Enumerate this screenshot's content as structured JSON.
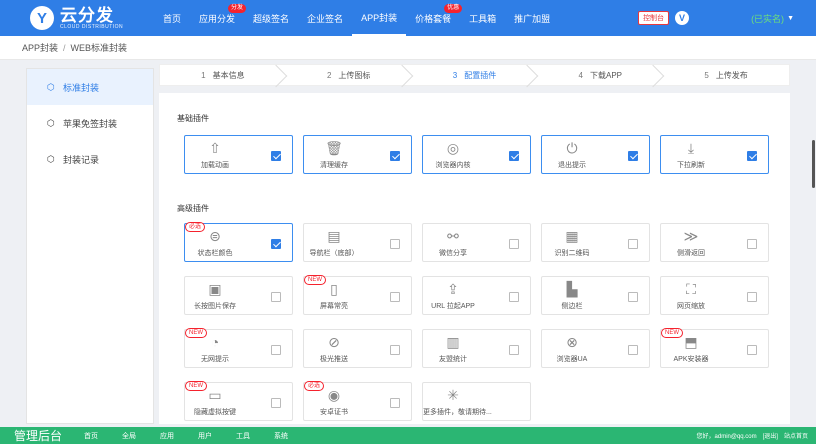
{
  "brand": {
    "name": "云分发",
    "sub": "CLOUD DISTRIBUTION",
    "letter": "Y"
  },
  "nav": {
    "items": [
      {
        "label": "首页",
        "badge": ""
      },
      {
        "label": "应用分发",
        "badge": "分发"
      },
      {
        "label": "超级签名",
        "badge": ""
      },
      {
        "label": "企业签名",
        "badge": ""
      },
      {
        "label": "APP封装",
        "badge": "",
        "active": true
      },
      {
        "label": "价格套餐",
        "badge": "优惠"
      },
      {
        "label": "工具箱",
        "badge": ""
      },
      {
        "label": "推广加盟",
        "badge": ""
      }
    ],
    "ctrl_label": "控制台",
    "vip": "V",
    "realname": "(已实名)",
    "caret": "▼"
  },
  "breadcrumb": {
    "a": "APP封装",
    "sep": "/",
    "b": "WEB标准封装"
  },
  "sidebar": [
    {
      "label": "标准封装",
      "icon": "⬡",
      "active": true
    },
    {
      "label": "苹果免签封装",
      "icon": "⬡"
    },
    {
      "label": "封装记录",
      "icon": "⬡"
    }
  ],
  "steps": [
    {
      "num": "1",
      "label": "基本信息"
    },
    {
      "num": "2",
      "label": "上传图标"
    },
    {
      "num": "3",
      "label": "配置插件",
      "active": true
    },
    {
      "num": "4",
      "label": "下载APP"
    },
    {
      "num": "5",
      "label": "上传发布"
    }
  ],
  "sections": {
    "basic": "基础插件",
    "advanced": "高级插件"
  },
  "basic_plugins": [
    {
      "label": "加载动画",
      "icon": "⇧",
      "checked": true
    },
    {
      "label": "清理缓存",
      "icon": "🗑",
      "checked": true
    },
    {
      "label": "浏览器内核",
      "icon": "◎",
      "checked": true
    },
    {
      "label": "退出提示",
      "icon": "⏻",
      "checked": true
    },
    {
      "label": "下拉刷新",
      "icon": "⤓",
      "checked": true
    }
  ],
  "advanced_plugins": [
    {
      "label": "状态栏颜色",
      "icon": "⊜",
      "checked": true,
      "tag": "必选"
    },
    {
      "label": "导航栏（底部）",
      "icon": "▤",
      "checked": false
    },
    {
      "label": "微信分享",
      "icon": "⚯",
      "checked": false
    },
    {
      "label": "识别二维码",
      "icon": "▦",
      "checked": false
    },
    {
      "label": "侧滑返回",
      "icon": "≫",
      "checked": false
    },
    {
      "label": "长按图片保存",
      "icon": "▣",
      "checked": false
    },
    {
      "label": "屏幕常亮",
      "icon": "▯",
      "checked": false,
      "tag": "NEW"
    },
    {
      "label": "URL 拉起APP",
      "icon": "⇪",
      "checked": false
    },
    {
      "label": "侧边栏",
      "icon": "▙",
      "checked": false
    },
    {
      "label": "网页缩放",
      "icon": "⛶",
      "checked": false
    },
    {
      "label": "无网提示",
      "icon": "◔",
      "checked": false,
      "tag": "NEW"
    },
    {
      "label": "极光推送",
      "icon": "⊘",
      "checked": false
    },
    {
      "label": "友盟统计",
      "icon": "▥",
      "checked": false
    },
    {
      "label": "浏览器UA",
      "icon": "⊗",
      "checked": false
    },
    {
      "label": "APK安装器",
      "icon": "⬒",
      "checked": false,
      "tag": "NEW"
    },
    {
      "label": "隐藏虚拟按键",
      "icon": "▭",
      "checked": false,
      "tag": "NEW"
    },
    {
      "label": "安卓证书",
      "icon": "◉",
      "checked": false,
      "tag": "必选"
    },
    {
      "label": "更多插件，敬请期待...",
      "icon": "✳",
      "checked": null
    }
  ],
  "bottom": {
    "title": "管理后台",
    "items": [
      "首页",
      "全局",
      "应用",
      "用户",
      "工具",
      "系统"
    ],
    "greeting": "您好，admin@qq.com",
    "logout": "[退出]",
    "site": "站点首页"
  }
}
